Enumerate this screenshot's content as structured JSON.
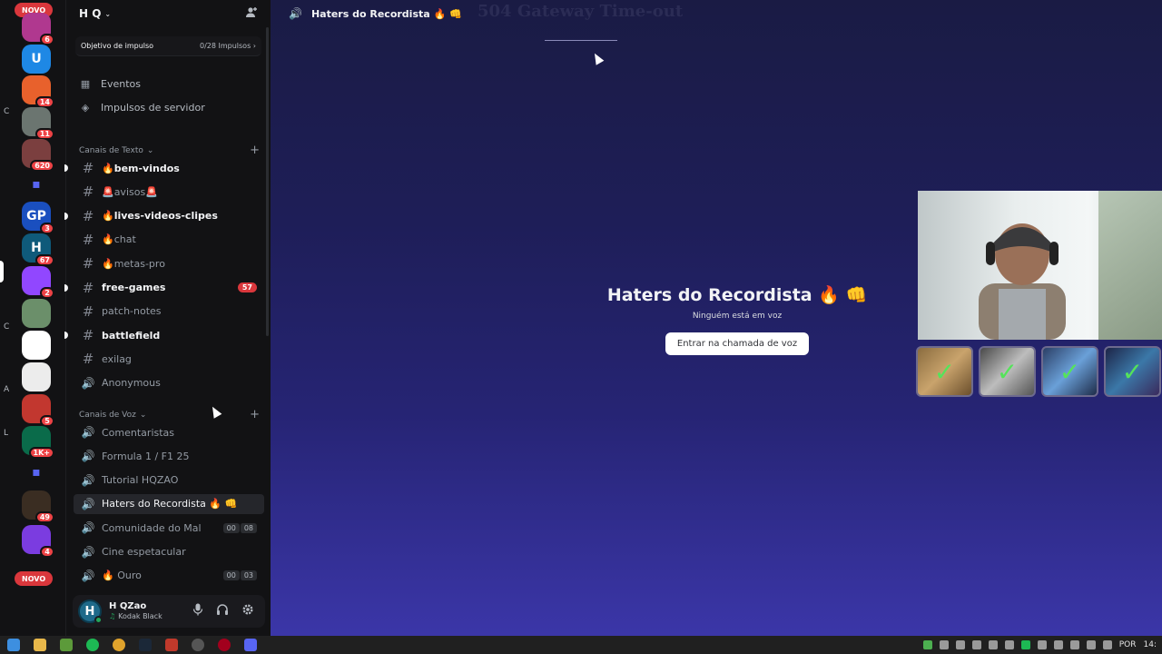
{
  "rail": {
    "novo_top": "NOVO",
    "novo_bottom": "NOVO",
    "servers": [
      {
        "letter": "",
        "color": "#b0388f",
        "badge": "6"
      },
      {
        "letter": "U",
        "color": "#1e88e5",
        "badge": ""
      },
      {
        "letter": "",
        "color": "#e8612c",
        "badge": "14"
      },
      {
        "letter": "",
        "color": "#6b7570",
        "badge": "11"
      },
      {
        "letter": "",
        "color": "#7b3f3f",
        "badge": "620"
      },
      {
        "letter": "▪",
        "color": "#121214",
        "badge": ""
      },
      {
        "letter": "GP",
        "color": "#1a4fbf",
        "badge": "3"
      },
      {
        "letter": "H",
        "color": "#0f5a7a",
        "badge": "67"
      },
      {
        "letter": "",
        "color": "#9147ff",
        "badge": "2"
      },
      {
        "letter": "",
        "color": "#6b8f6a",
        "badge": ""
      },
      {
        "letter": "",
        "color": "#ffffff",
        "badge": ""
      },
      {
        "letter": "",
        "color": "#ececec",
        "badge": ""
      },
      {
        "letter": "",
        "color": "#c2372f",
        "badge": "5"
      },
      {
        "letter": "",
        "color": "#0a6b4a",
        "badge": "1K+"
      },
      {
        "letter": "▪",
        "color": "#121214",
        "badge": ""
      },
      {
        "letter": "",
        "color": "#3a2d22",
        "badge": "49"
      },
      {
        "letter": "",
        "color": "#7b3ce0",
        "badge": "4"
      }
    ],
    "side_glyphs": [
      "C",
      "C",
      "A",
      "L"
    ]
  },
  "sidebar": {
    "server_name": "H Q",
    "boost": {
      "label": "Objetivo de impulso",
      "progress": "0/28 Impulsos"
    },
    "events_label": "Eventos",
    "boosts_label": "Impulsos de servidor",
    "text_category": "Canais de Texto",
    "text_channels": [
      {
        "name": "🔥bem-vindos",
        "unread": true,
        "count": ""
      },
      {
        "name": "🚨avisos🚨",
        "unread": false,
        "count": ""
      },
      {
        "name": "🔥lives-videos-clipes",
        "unread": true,
        "count": ""
      },
      {
        "name": "🔥chat",
        "unread": false,
        "count": ""
      },
      {
        "name": "🔥metas-pro",
        "unread": false,
        "count": ""
      },
      {
        "name": "free-games",
        "unread": true,
        "count": "57"
      },
      {
        "name": "patch-notes",
        "unread": false,
        "count": ""
      },
      {
        "name": "battlefield",
        "unread": true,
        "count": ""
      },
      {
        "name": "exilag",
        "unread": false,
        "count": ""
      },
      {
        "name": "Anonymous",
        "unread": false,
        "count": ""
      }
    ],
    "voice_category": "Canais de Voz",
    "voice_channels": [
      {
        "name": "Comentaristas",
        "selected": false,
        "timer": []
      },
      {
        "name": "Formula 1 / F1 25",
        "selected": false,
        "timer": []
      },
      {
        "name": "Tutorial HQZAO",
        "selected": false,
        "timer": []
      },
      {
        "name": "Haters do Recordista 🔥 👊",
        "selected": true,
        "timer": []
      },
      {
        "name": "Comunidade do Mal",
        "selected": false,
        "timer": [
          "00",
          "08"
        ]
      },
      {
        "name": "Cine espetacular",
        "selected": false,
        "timer": []
      },
      {
        "name": "🔥 Ouro",
        "selected": false,
        "timer": [
          "00",
          "03"
        ]
      }
    ],
    "user": {
      "name": "H QZao",
      "activity": "Kodak Black",
      "avatar_letter": "H"
    }
  },
  "main": {
    "channel_title": "Haters do Recordista 🔥 👊",
    "gateway_text": "504 Gateway Time-out",
    "center_title": "Haters do Recordista 🔥 👊",
    "center_sub": "Ninguém está em voz",
    "join_label": "Entrar na chamada de voz"
  },
  "taskbar": {
    "lang": "POR",
    "time": "14:"
  }
}
